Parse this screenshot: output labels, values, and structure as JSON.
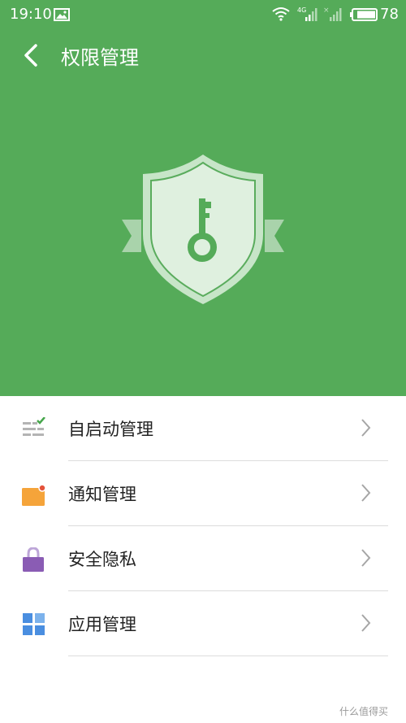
{
  "status_bar": {
    "time": "19:10",
    "network_label": "4G",
    "battery_percent": "78"
  },
  "header": {
    "title": "权限管理",
    "background_color": "#55ab59"
  },
  "menu": {
    "items": [
      {
        "label": "自启动管理",
        "icon": "autostart-list-icon"
      },
      {
        "label": "通知管理",
        "icon": "notification-icon"
      },
      {
        "label": "安全隐私",
        "icon": "lock-icon"
      },
      {
        "label": "应用管理",
        "icon": "app-grid-icon"
      }
    ]
  },
  "watermark": "什么值得买"
}
